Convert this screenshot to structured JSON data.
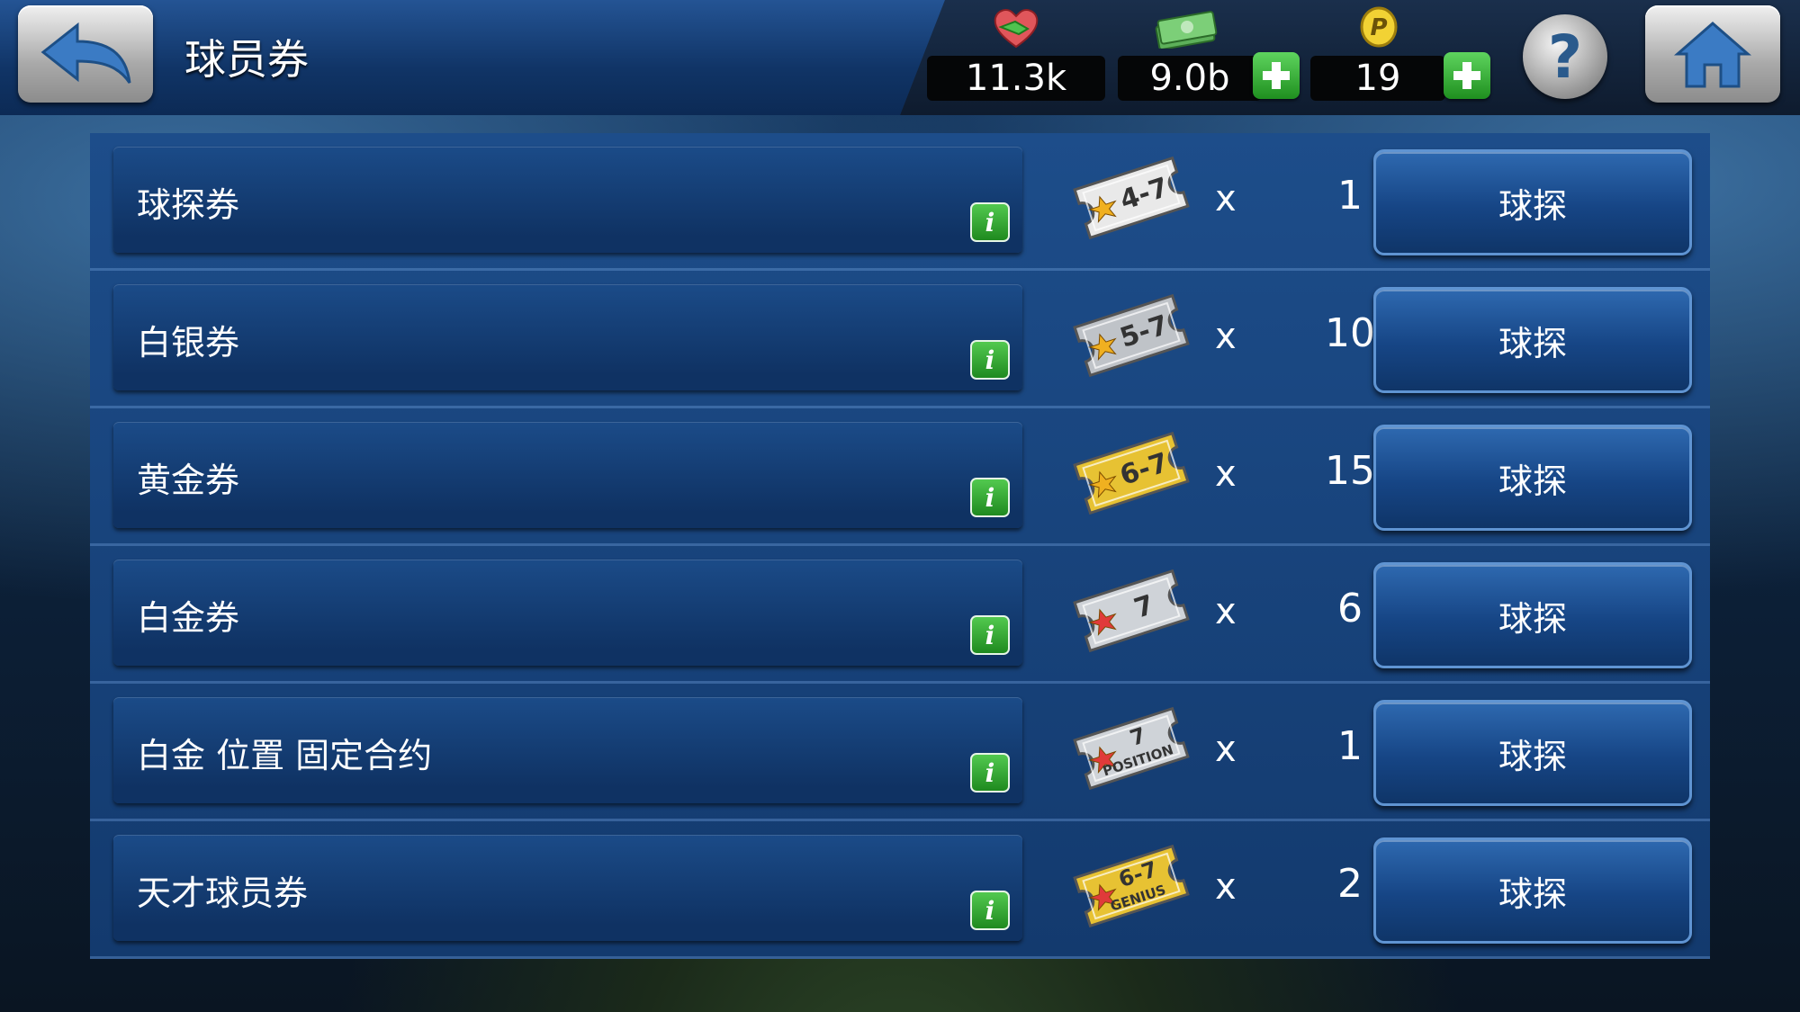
{
  "header": {
    "title": "球员券",
    "back_icon": "back-arrow-icon",
    "home_icon": "home-icon",
    "help_icon": "help-icon",
    "help_glyph": "?"
  },
  "currencies": [
    {
      "name": "handshake",
      "icon": "handshake-icon",
      "value": "11.3k",
      "has_plus": false
    },
    {
      "name": "money",
      "icon": "money-icon",
      "value": "9.0b",
      "has_plus": true
    },
    {
      "name": "points",
      "icon": "p-coin-icon",
      "icon_letter": "P",
      "value": "19",
      "has_plus": true
    }
  ],
  "tickets": [
    {
      "name": "球探券",
      "ticket_label": "4-7",
      "sublabel": "",
      "ticket_color": "#e9e9e9",
      "x": "x",
      "count": "1",
      "button": "球探"
    },
    {
      "name": "白银券",
      "ticket_label": "5-7",
      "sublabel": "",
      "ticket_color": "#bfc3c8",
      "x": "x",
      "count": "10",
      "button": "球探"
    },
    {
      "name": "黄金券",
      "ticket_label": "6-7",
      "sublabel": "",
      "ticket_color": "#e7c233",
      "x": "x",
      "count": "15",
      "button": "球探"
    },
    {
      "name": "白金券",
      "ticket_label": "7",
      "sublabel": "",
      "ticket_color": "#cfd3d8",
      "x": "x",
      "count": "6",
      "button": "球探"
    },
    {
      "name": "白金 位置 固定合约",
      "ticket_label": "7",
      "sublabel": "POSITION",
      "ticket_color": "#cfd3d8",
      "x": "x",
      "count": "1",
      "button": "球探"
    },
    {
      "name": "天才球员券",
      "ticket_label": "6-7",
      "sublabel": "GENIUS",
      "ticket_color": "#e7c233",
      "x": "x",
      "count": "2",
      "button": "球探"
    }
  ],
  "colors": {
    "accent_green": "#2fa62f",
    "panel_blue": "#1d4d8a"
  }
}
